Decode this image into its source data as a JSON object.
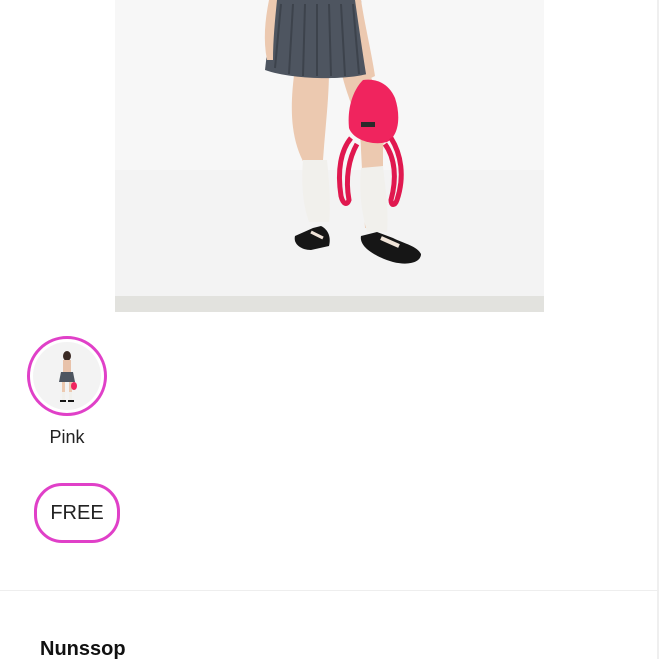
{
  "product": {
    "color_options": [
      {
        "label": "Pink",
        "selected": true
      }
    ],
    "size_options": [
      {
        "label": "FREE",
        "selected": true
      }
    ]
  },
  "seller": {
    "name": "Nunssop"
  },
  "colors": {
    "selection_accent": "#e040c8",
    "bag_pink": "#f0245e",
    "skirt_gray": "#4e5560"
  }
}
